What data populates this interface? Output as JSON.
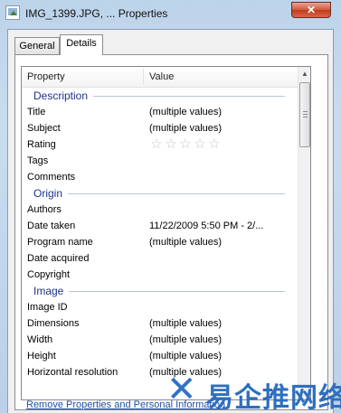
{
  "window": {
    "title": "IMG_1399.JPG, ... Properties",
    "close_glyph": "✕"
  },
  "tabs": [
    {
      "label": "General",
      "selected": false
    },
    {
      "label": "Details",
      "selected": true
    }
  ],
  "list": {
    "columns": {
      "property": "Property",
      "value": "Value"
    },
    "groups": [
      {
        "label": "Description",
        "rows": [
          {
            "property": "Title",
            "value": "(multiple values)"
          },
          {
            "property": "Subject",
            "value": "(multiple values)"
          },
          {
            "property": "Rating",
            "value": "",
            "rating_stars": 5
          },
          {
            "property": "Tags",
            "value": ""
          },
          {
            "property": "Comments",
            "value": ""
          }
        ]
      },
      {
        "label": "Origin",
        "rows": [
          {
            "property": "Authors",
            "value": ""
          },
          {
            "property": "Date taken",
            "value": "11/22/2009 5:50 PM - 2/..."
          },
          {
            "property": "Program name",
            "value": "(multiple values)"
          },
          {
            "property": "Date acquired",
            "value": ""
          },
          {
            "property": "Copyright",
            "value": ""
          }
        ]
      },
      {
        "label": "Image",
        "rows": [
          {
            "property": "Image ID",
            "value": ""
          },
          {
            "property": "Dimensions",
            "value": "(multiple values)"
          },
          {
            "property": "Width",
            "value": "(multiple values)"
          },
          {
            "property": "Height",
            "value": "(multiple values)"
          },
          {
            "property": "Horizontal resolution",
            "value": "(multiple values)"
          }
        ]
      }
    ]
  },
  "footer": {
    "remove_link": "Remove Properties and Personal Information"
  },
  "watermark": {
    "mark_glyph": "✕",
    "text": "易企推网络"
  }
}
